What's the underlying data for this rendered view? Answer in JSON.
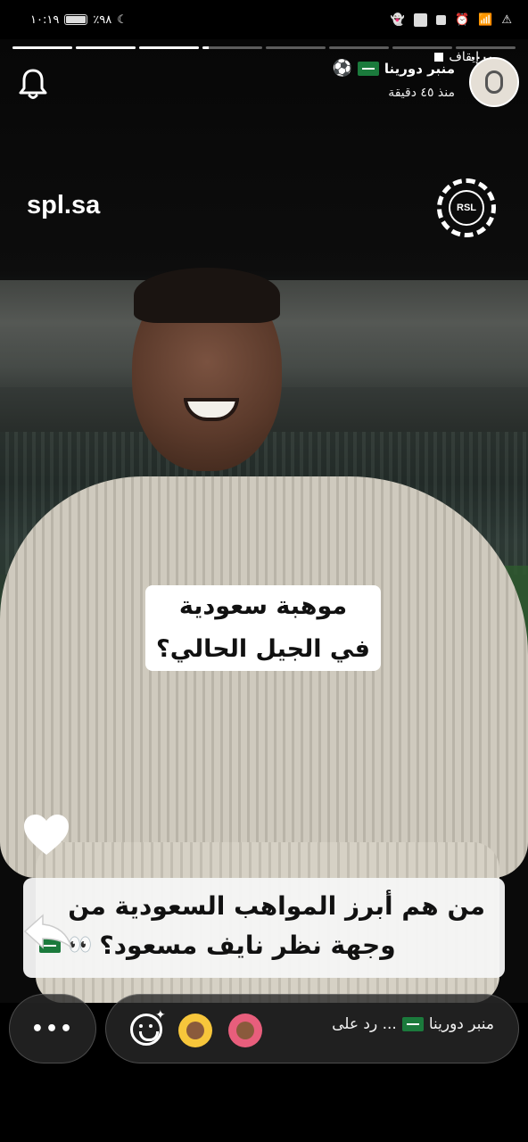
{
  "status_bar": {
    "time": "١٠:١٩",
    "battery_text": "٪٩٨",
    "battery_level": 0.98
  },
  "story": {
    "progress_segments": [
      1,
      1,
      1,
      0.1,
      0,
      0,
      0,
      0
    ],
    "pause_label": "إيقاف",
    "more_label": "····",
    "account_name": "منبر دورينا",
    "time_ago": "منذ ٤٥ دقيقة",
    "watermark_left": "spl.sa",
    "watermark_logo": "RSL",
    "video_caption": [
      "موهبة سعودية",
      "في الجيل الحالي؟"
    ],
    "story_caption": {
      "line1": "من هم أبرز المواهب السعودية من",
      "line2": "وجهة نظر نايف مسعود؟"
    }
  },
  "reply": {
    "more_label": "•••",
    "reply_prefix": "رد على ...",
    "reply_account": "منبر دورينا"
  },
  "icons": {
    "bell": "bell-icon",
    "heart": "heart-icon",
    "share": "share-arrow-icon",
    "emoji": "emoji-add-icon",
    "flag": "saudi-flag-icon",
    "ball": "soccer-ball-icon"
  }
}
